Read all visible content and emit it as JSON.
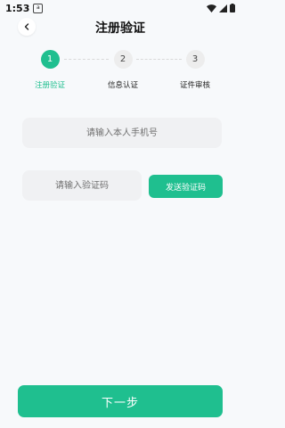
{
  "status_bar": {
    "time": "1:53",
    "notification_icon": "a"
  },
  "header": {
    "title": "注册验证"
  },
  "stepper": {
    "steps": [
      {
        "number": "1",
        "label": "注册验证",
        "active": true
      },
      {
        "number": "2",
        "label": "信息认证",
        "active": false
      },
      {
        "number": "3",
        "label": "证件审核",
        "active": false
      }
    ]
  },
  "form": {
    "phone_placeholder": "请输入本人手机号",
    "code_placeholder": "请输入验证码",
    "send_code_label": "发送验证码"
  },
  "footer": {
    "next_label": "下一步"
  },
  "colors": {
    "accent": "#1fbf8f",
    "background": "#f7f9fb",
    "input_bg": "#f0f1f3"
  }
}
